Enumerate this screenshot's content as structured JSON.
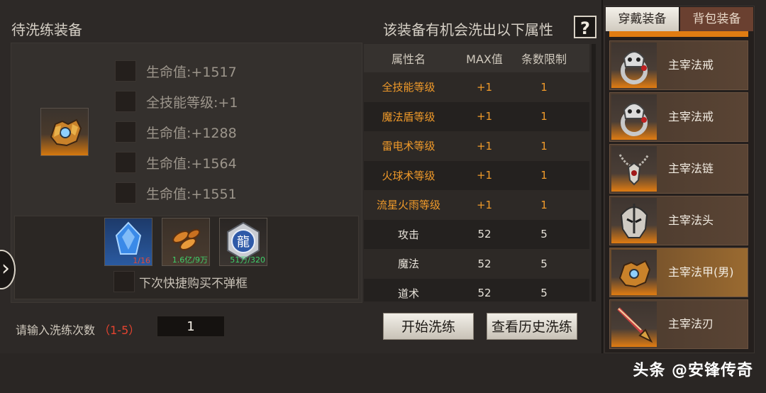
{
  "left_title": "待洗练装备",
  "right_title": "该装备有机会洗出以下属性",
  "help_label": "?",
  "equip_name": "主宰法甲(男)",
  "attributes": [
    {
      "label": "生命值:+1517"
    },
    {
      "label": "全技能等级:+1"
    },
    {
      "label": "生命值:+1288"
    },
    {
      "label": "生命值:+1564"
    },
    {
      "label": "生命值:+1551"
    }
  ],
  "materials": [
    {
      "icon": "blue-crystal-icon",
      "count": "1/16",
      "count_color": "red"
    },
    {
      "icon": "gold-coins-icon",
      "count": "1.6亿/9万",
      "count_color": "green"
    },
    {
      "icon": "dragon-token-icon",
      "count": "51万/320",
      "count_color": "green"
    }
  ],
  "no_popup_label": "下次快捷购买不弹框",
  "count_label": "请输入洗练次数",
  "count_range": "（1-5）",
  "count_value": "1",
  "start_button": "开始洗练",
  "history_button": "查看历史洗练",
  "table": {
    "headers": [
      "属性名",
      "MAX值",
      "条数限制"
    ],
    "rows": [
      {
        "name": "全技能等级",
        "max": "+1",
        "limit": "1",
        "color": "orange"
      },
      {
        "name": "魔法盾等级",
        "max": "+1",
        "limit": "1",
        "color": "orange"
      },
      {
        "name": "雷电术等级",
        "max": "+1",
        "limit": "1",
        "color": "orange"
      },
      {
        "name": "火球术等级",
        "max": "+1",
        "limit": "1",
        "color": "orange"
      },
      {
        "name": "流星火雨等级",
        "max": "+1",
        "limit": "1",
        "color": "orange"
      },
      {
        "name": "攻击",
        "max": "52",
        "limit": "5",
        "color": "white"
      },
      {
        "name": "魔法",
        "max": "52",
        "limit": "5",
        "color": "white"
      },
      {
        "name": "道术",
        "max": "52",
        "limit": "5",
        "color": "white"
      }
    ]
  },
  "tabs": {
    "worn": "穿戴装备",
    "bag": "背包装备"
  },
  "equipment_list": [
    {
      "name": "主宰法戒",
      "icon": "skull-ring-icon",
      "selected": false
    },
    {
      "name": "主宰法戒",
      "icon": "skull-ring-icon",
      "selected": false
    },
    {
      "name": "主宰法链",
      "icon": "necklace-icon",
      "selected": false
    },
    {
      "name": "主宰法头",
      "icon": "helmet-icon",
      "selected": false
    },
    {
      "name": "主宰法甲(男)",
      "icon": "armor-icon",
      "selected": true
    },
    {
      "name": "主宰法刃",
      "icon": "blade-icon",
      "selected": false
    }
  ],
  "watermark": "头条 @安锋传奇",
  "colors": {
    "orange_text": "#f09a2a",
    "red_text": "#e5432f",
    "green_text": "#3fd06a",
    "accent_orange": "#e07c12"
  }
}
